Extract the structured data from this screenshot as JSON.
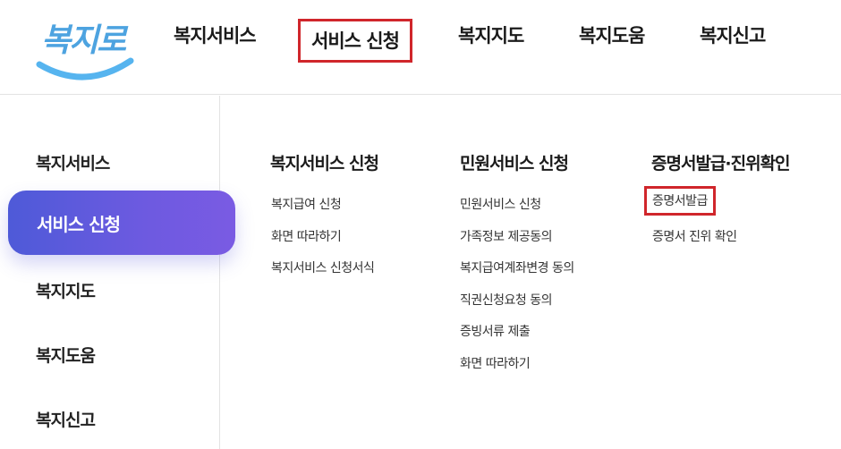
{
  "logo": {
    "text": "복지로"
  },
  "gnb": {
    "items": [
      "복지서비스",
      "서비스 신청",
      "복지지도",
      "복지도움",
      "복지신고"
    ]
  },
  "sidebar": {
    "items": [
      "복지서비스",
      "서비스 신청",
      "복지지도",
      "복지도움",
      "복지신고"
    ],
    "active_index": 1
  },
  "columns": [
    {
      "title": "복지서비스 신청",
      "links": [
        "복지급여 신청",
        "화면 따라하기",
        "복지서비스 신청서식"
      ]
    },
    {
      "title": "민원서비스 신청",
      "links": [
        "민원서비스 신청",
        "가족정보 제공동의",
        "복지급여계좌변경 동의",
        "직권신청요청 동의",
        "증빙서류 제출",
        "화면 따라하기"
      ]
    },
    {
      "title": "증명서발급·진위확인",
      "links": [
        "증명서발급",
        "증명서 진위 확인"
      ]
    }
  ],
  "colors": {
    "highlight_box": "#d0262b",
    "active_gradient_start": "#4e5ad8",
    "active_gradient_end": "#7a5be3",
    "logo_blue": "#4da3e0"
  }
}
